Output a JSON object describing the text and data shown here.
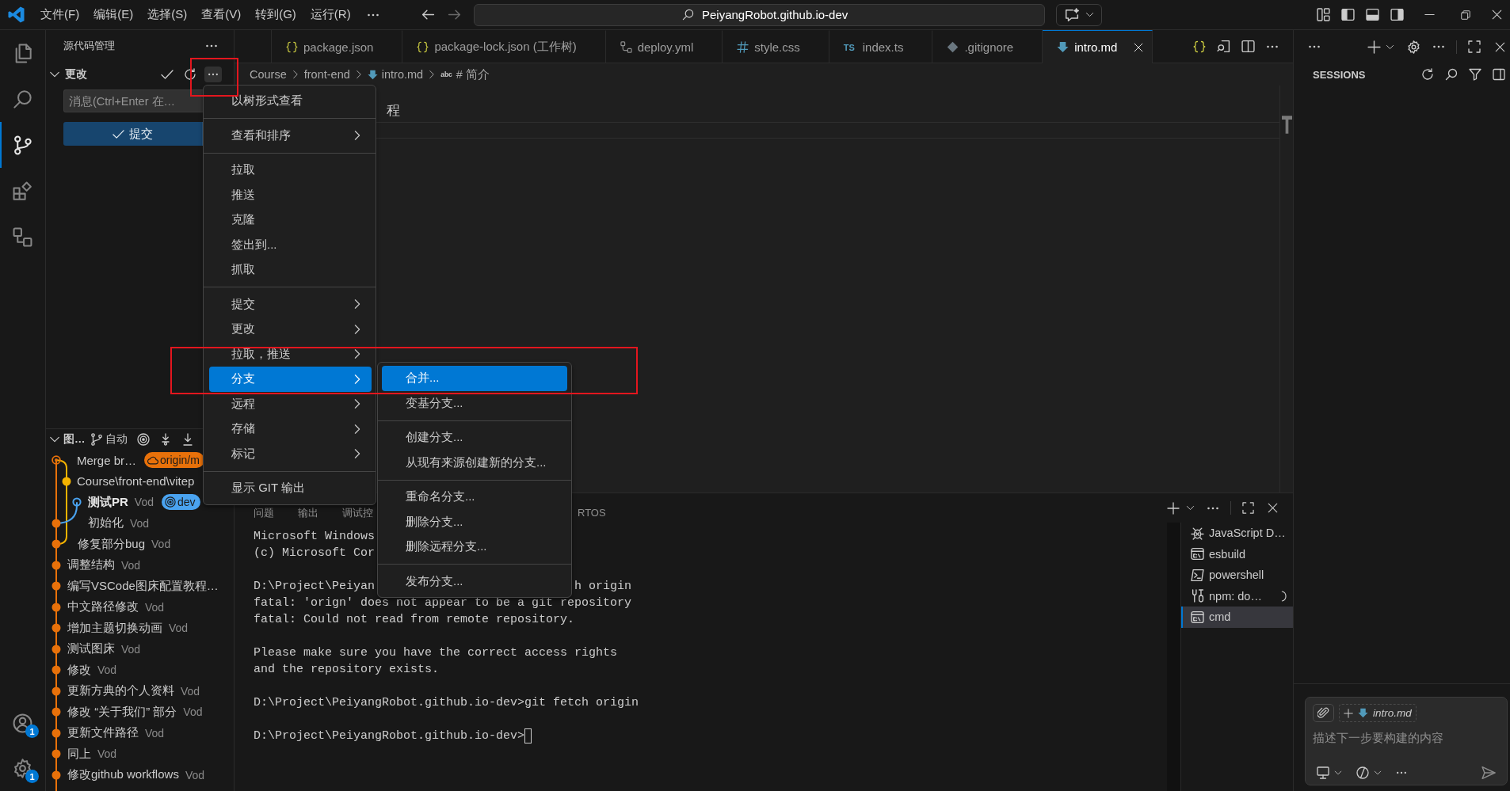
{
  "title_bar": {
    "menus": [
      "文件(F)",
      "编辑(E)",
      "选择(S)",
      "查看(V)",
      "转到(G)",
      "运行(R)"
    ],
    "command_center": "PeiyangRobot.github.io-dev"
  },
  "activity_bar": {
    "items": [
      {
        "kind": "explorer",
        "selected": false
      },
      {
        "kind": "search",
        "selected": false
      },
      {
        "kind": "source-control",
        "selected": true
      },
      {
        "kind": "extensions",
        "selected": false
      },
      {
        "kind": "remote",
        "selected": false
      }
    ],
    "accounts_badge": "1",
    "settings_badge": "1"
  },
  "sidebar": {
    "title": "源代码管理",
    "changes": {
      "label": "更改",
      "expanded": true
    },
    "message": {
      "placeholder": "消息(Ctrl+Enter 在…"
    },
    "commit_button": {
      "label": "提交",
      "disabled": true
    },
    "graph": {
      "label": "图…",
      "expanded": true,
      "branch_label": "自动",
      "commits": [
        {
          "message": "Merge br…",
          "kind": "merge",
          "color": "#e8710a",
          "badges": [
            {
              "label": "origin/m",
              "kind": "remote",
              "color": "#e8710a"
            }
          ]
        },
        {
          "message": "Course\\front-end\\vitep",
          "kind": "commit",
          "color": "#f4b400"
        },
        {
          "message": "测试PR",
          "author": "Vod",
          "kind": "head",
          "color": "#4aa3f0",
          "badges": [
            {
              "label": "dev",
              "kind": "local",
              "color": "#4aa3f0"
            }
          ]
        },
        {
          "message": "初始化",
          "author": "Vod",
          "kind": "commit",
          "color": "#e8710a"
        },
        {
          "message": "修复部分bug",
          "author": "Vod",
          "kind": "commit",
          "color": "#e8710a"
        },
        {
          "message": "调整结构",
          "author": "Vod",
          "kind": "commit",
          "color": "#e8710a"
        },
        {
          "message": "编写VSCode图床配置教程…",
          "kind": "commit",
          "color": "#e8710a"
        },
        {
          "message": "中文路径修改",
          "author": "Vod",
          "kind": "commit",
          "color": "#e8710a"
        },
        {
          "message": "增加主题切换动画",
          "author": "Vod",
          "kind": "commit",
          "color": "#e8710a"
        },
        {
          "message": "测试图床",
          "author": "Vod",
          "kind": "commit",
          "color": "#e8710a"
        },
        {
          "message": "修改",
          "author": "Vod",
          "kind": "commit",
          "color": "#e8710a"
        },
        {
          "message": "更新方典的个人资料",
          "author": "Vod",
          "kind": "commit",
          "color": "#e8710a"
        },
        {
          "message": "修改 “关于我们” 部分",
          "author": "Vod",
          "kind": "commit",
          "color": "#e8710a"
        },
        {
          "message": "更新文件路径",
          "author": "Vod",
          "kind": "commit",
          "color": "#e8710a"
        },
        {
          "message": "同上",
          "author": "Vod",
          "kind": "commit",
          "color": "#e8710a"
        },
        {
          "message": "修改github workflows",
          "author": "Vod",
          "kind": "commit",
          "color": "#e8710a"
        }
      ]
    }
  },
  "tabs": [
    {
      "label": "package.json",
      "kind": "json",
      "selected": false
    },
    {
      "label": "package-lock.json (工作树)",
      "kind": "json",
      "selected": false
    },
    {
      "label": "deploy.yml",
      "kind": "workflow",
      "selected": false
    },
    {
      "label": "style.css",
      "kind": "css",
      "selected": false
    },
    {
      "label": "index.ts",
      "kind": "ts",
      "icon_text": "TS",
      "selected": false
    },
    {
      "label": ".gitignore",
      "kind": "git",
      "selected": false
    },
    {
      "label": "intro.md",
      "kind": "markdown",
      "selected": true
    }
  ],
  "breadcrumb": [
    {
      "label": "Course",
      "kind": "folder"
    },
    {
      "label": "front-end",
      "kind": "folder"
    },
    {
      "label": "intro.md",
      "kind": "markdown"
    },
    {
      "label": "# 简介",
      "kind": "symbol",
      "symbol": "abc"
    }
  ],
  "editor": {
    "sticky_line": "程"
  },
  "context_menu": {
    "groups": [
      [
        {
          "label": "以树形式查看",
          "submenu": false,
          "selected": false
        }
      ],
      [
        {
          "label": "查看和排序",
          "submenu": true,
          "selected": false
        }
      ],
      [
        {
          "label": "拉取",
          "submenu": false,
          "selected": false
        },
        {
          "label": "推送",
          "submenu": false,
          "selected": false
        },
        {
          "label": "克隆",
          "submenu": false,
          "selected": false
        },
        {
          "label": "签出到...",
          "submenu": false,
          "selected": false
        },
        {
          "label": "抓取",
          "submenu": false,
          "selected": false
        }
      ],
      [
        {
          "label": "提交",
          "submenu": true,
          "selected": false
        },
        {
          "label": "更改",
          "submenu": true,
          "selected": false
        },
        {
          "label": "拉取，推送",
          "submenu": true,
          "selected": false
        },
        {
          "label": "分支",
          "submenu": true,
          "selected": true
        },
        {
          "label": "远程",
          "submenu": true,
          "selected": false
        },
        {
          "label": "存储",
          "submenu": true,
          "selected": false
        },
        {
          "label": "标记",
          "submenu": true,
          "selected": false
        }
      ],
      [
        {
          "label": "显示 GIT 输出",
          "submenu": false,
          "selected": false
        }
      ]
    ]
  },
  "submenu": {
    "groups": [
      [
        {
          "label": "合并...",
          "selected": true
        },
        {
          "label": "变基分支...",
          "selected": false
        }
      ],
      [
        {
          "label": "创建分支...",
          "selected": false
        },
        {
          "label": "从现有来源创建新的分支...",
          "selected": false
        }
      ],
      [
        {
          "label": "重命名分支...",
          "selected": false
        },
        {
          "label": "删除分支...",
          "selected": false
        },
        {
          "label": "删除远程分支...",
          "selected": false
        }
      ],
      [
        {
          "label": "发布分支...",
          "selected": false
        }
      ]
    ]
  },
  "panel": {
    "tabs": [
      {
        "label": "问题",
        "selected": false
      },
      {
        "label": "输出",
        "selected": false
      },
      {
        "label": "调试控",
        "selected": false
      },
      {
        "label": "RTOS",
        "selected": false
      }
    ],
    "terminal": {
      "groups": [
        {
          "lines": [
            {
              "segments": [
                "Microsoft Windows"
              ],
              "cursor": false
            },
            {
              "segments": [
                "(c) Microsoft Cor"
              ],
              "cursor": false
            }
          ]
        },
        {
          "lines": [
            {
              "segments": [
                "D:\\Project\\Peiyan",
                "h origin"
              ],
              "cursor": false
            },
            {
              "segments": [
                "fatal: 'orign' does not appear to be a git repository"
              ],
              "cursor": false
            },
            {
              "segments": [
                "fatal: Could not read from remote repository."
              ],
              "cursor": false
            }
          ]
        },
        {
          "lines": [
            {
              "segments": [
                "Please make sure you have the correct access rights"
              ],
              "cursor": false
            },
            {
              "segments": [
                "and the repository exists."
              ],
              "cursor": false
            }
          ]
        },
        {
          "lines": [
            {
              "segments": [
                "D:\\Project\\PeiyangRobot.github.io-dev>git fetch origin"
              ],
              "cursor": false
            }
          ]
        },
        {
          "lines": [
            {
              "segments": [
                "D:\\Project\\PeiyangRobot.github.io-dev>"
              ],
              "cursor": true
            }
          ]
        }
      ]
    },
    "terminals": [
      {
        "label": "JavaScript D…",
        "kind": "debug",
        "selected": false,
        "busy": false
      },
      {
        "label": "esbuild",
        "kind": "cmd",
        "selected": false,
        "busy": false
      },
      {
        "label": "powershell",
        "kind": "powershell",
        "selected": false,
        "busy": false
      },
      {
        "label": "npm: do…",
        "kind": "task",
        "selected": false,
        "busy": true
      },
      {
        "label": "cmd",
        "kind": "cmd",
        "selected": true,
        "busy": false
      }
    ]
  },
  "sessions": {
    "title": "SESSIONS"
  },
  "chat": {
    "attachment": "intro.md",
    "placeholder": "描述下一步要构建的内容"
  }
}
